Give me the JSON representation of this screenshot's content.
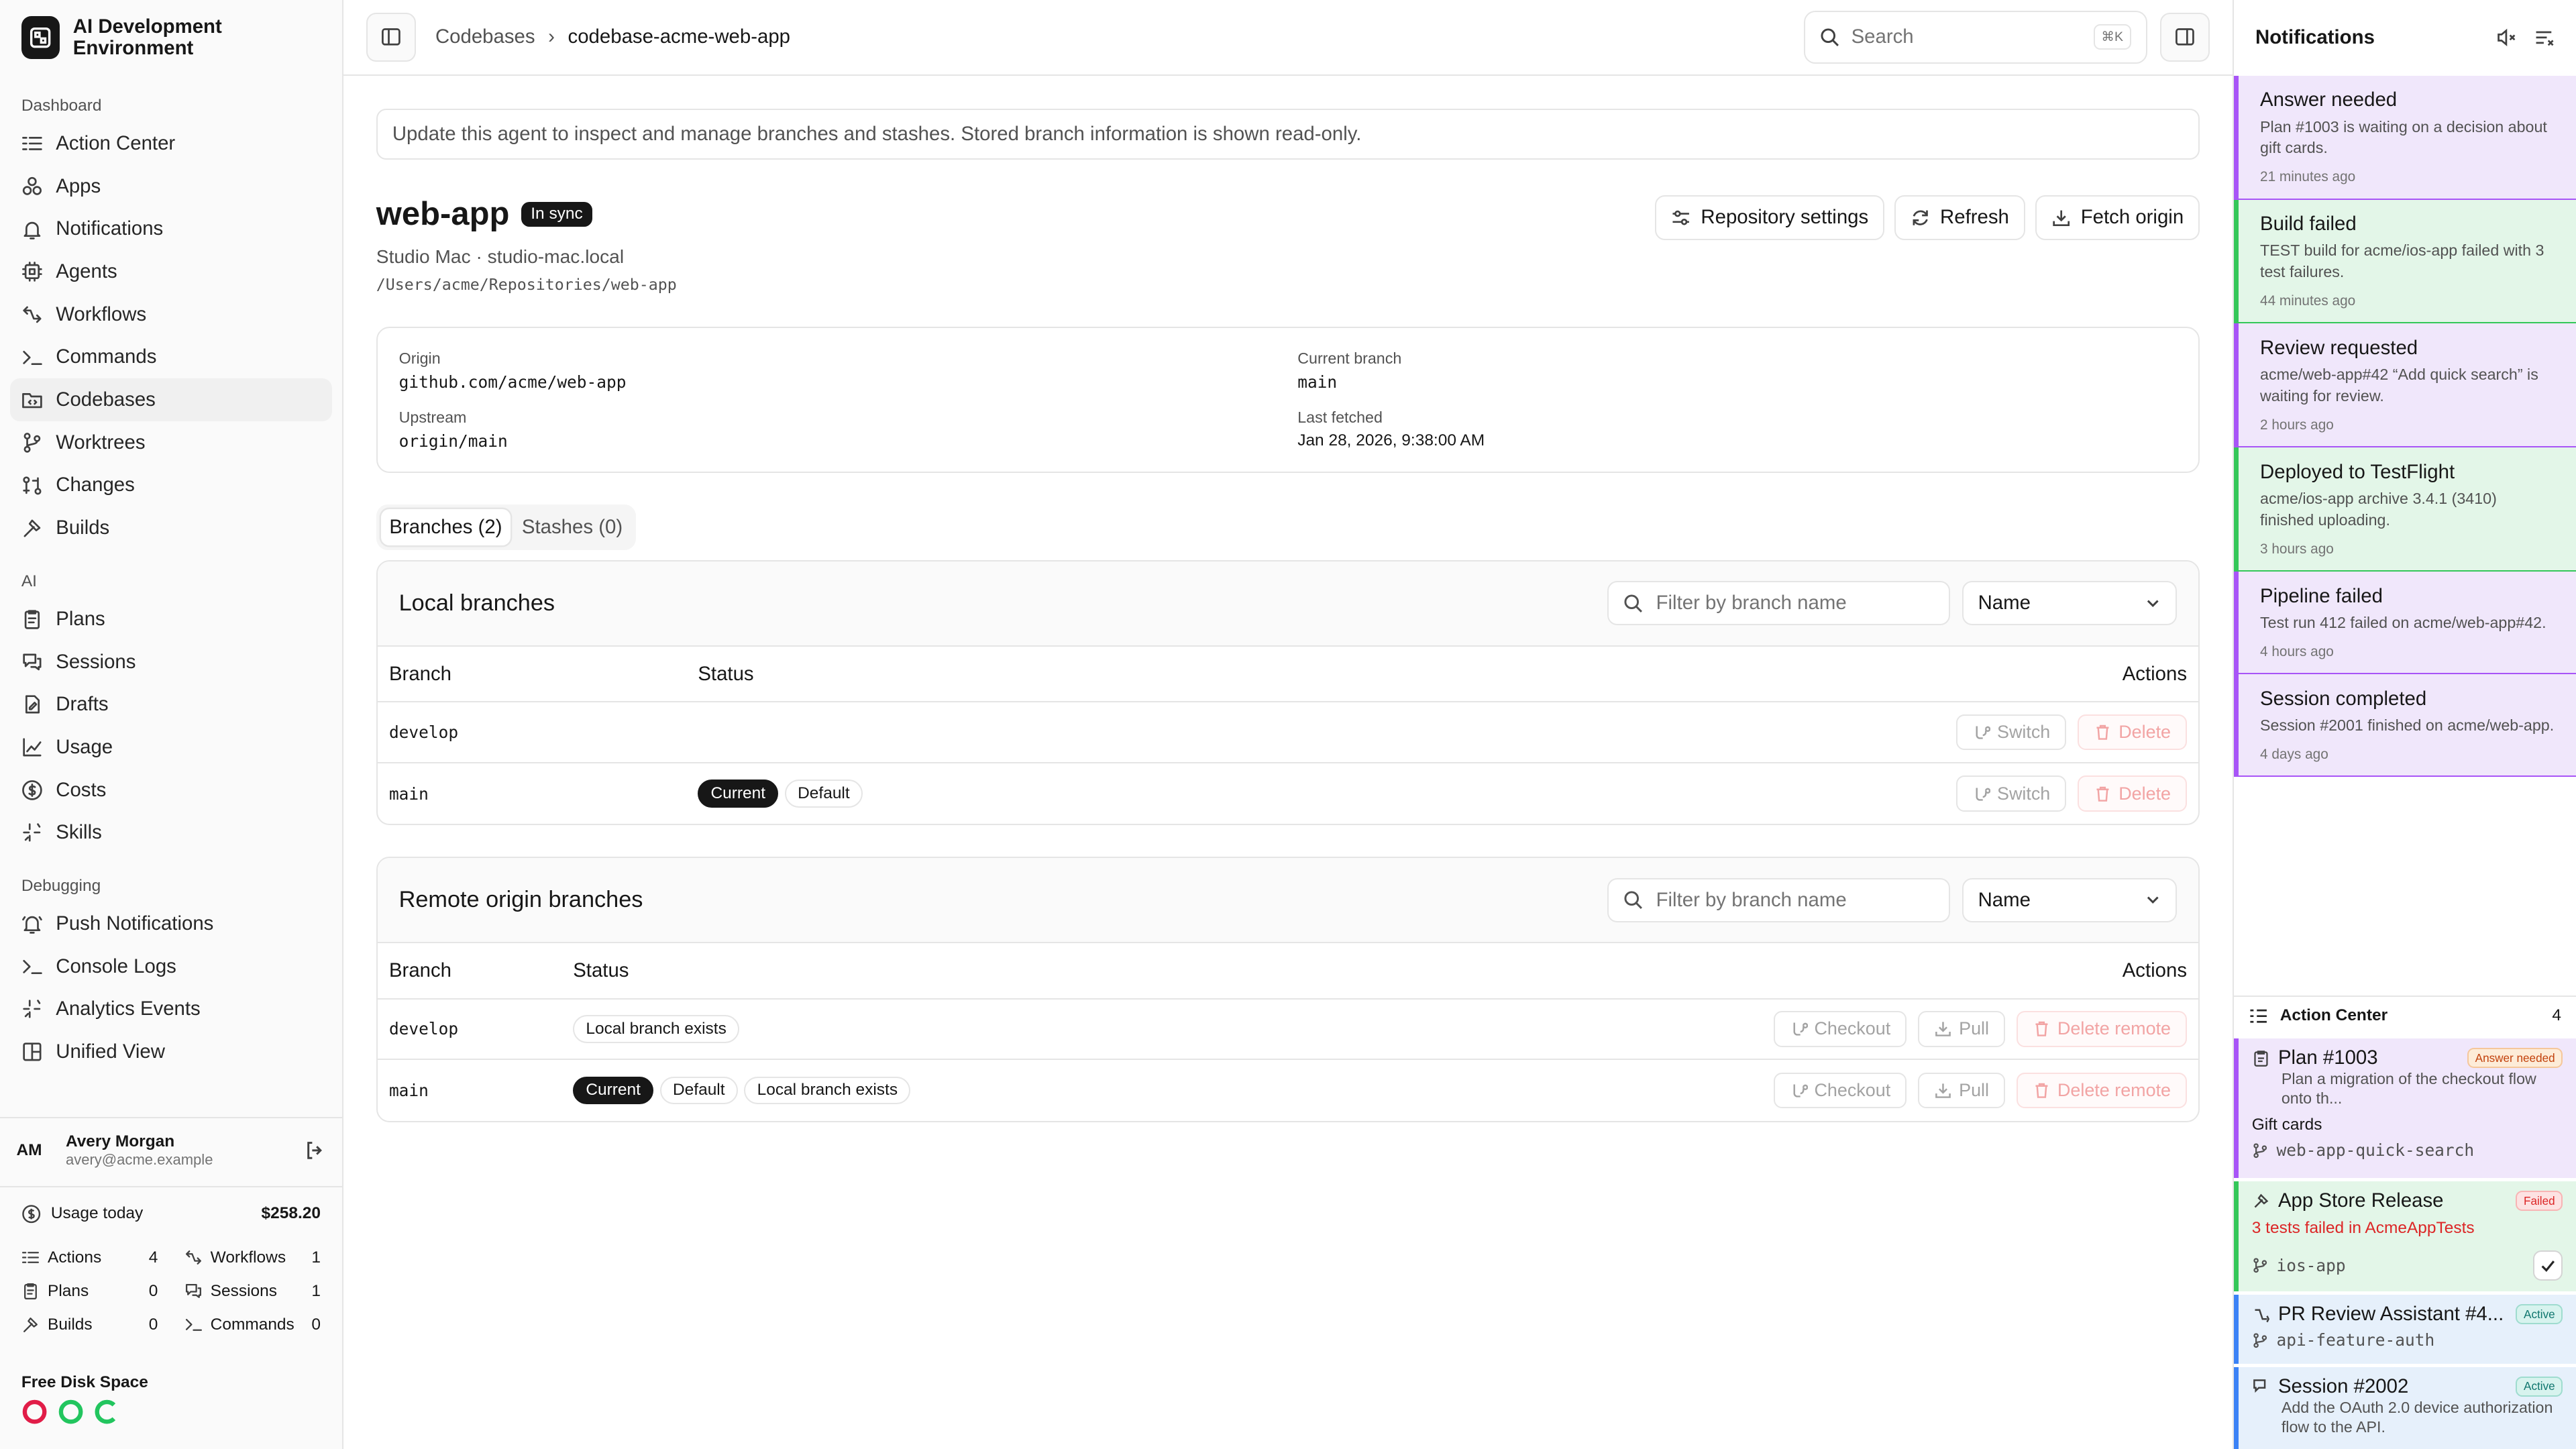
{
  "app": {
    "title": "AI Development Environment"
  },
  "sidebar": {
    "sections": [
      {
        "label": "Dashboard",
        "items": [
          {
            "label": "Action Center",
            "icon": "list-check-icon"
          },
          {
            "label": "Apps",
            "icon": "apps-icon"
          },
          {
            "label": "Notifications",
            "icon": "bell-icon"
          },
          {
            "label": "Agents",
            "icon": "cpu-icon"
          },
          {
            "label": "Workflows",
            "icon": "workflow-icon"
          },
          {
            "label": "Commands",
            "icon": "terminal-icon"
          },
          {
            "label": "Codebases",
            "icon": "folder-code-icon",
            "active": true
          },
          {
            "label": "Worktrees",
            "icon": "branch-icon"
          },
          {
            "label": "Changes",
            "icon": "diff-icon"
          },
          {
            "label": "Builds",
            "icon": "hammer-icon"
          }
        ]
      },
      {
        "label": "AI",
        "items": [
          {
            "label": "Plans",
            "icon": "clipboard-icon"
          },
          {
            "label": "Sessions",
            "icon": "chat-icon"
          },
          {
            "label": "Drafts",
            "icon": "file-edit-icon"
          },
          {
            "label": "Usage",
            "icon": "chart-icon"
          },
          {
            "label": "Costs",
            "icon": "dollar-icon"
          },
          {
            "label": "Skills",
            "icon": "sparkle-icon"
          }
        ]
      },
      {
        "label": "Debugging",
        "items": [
          {
            "label": "Push Notifications",
            "icon": "bell-ring-icon"
          },
          {
            "label": "Console Logs",
            "icon": "terminal-icon"
          },
          {
            "label": "Analytics Events",
            "icon": "sparkle-icon"
          },
          {
            "label": "Unified View",
            "icon": "layout-icon"
          }
        ]
      }
    ],
    "user": {
      "initials": "AM",
      "name": "Avery Morgan",
      "email": "avery@acme.example"
    },
    "usage": {
      "label": "Usage today",
      "amount": "$258.20"
    },
    "stats": [
      {
        "label": "Actions",
        "value": "4"
      },
      {
        "label": "Workflows",
        "value": "1"
      },
      {
        "label": "Plans",
        "value": "0"
      },
      {
        "label": "Sessions",
        "value": "1"
      },
      {
        "label": "Builds",
        "value": "0"
      },
      {
        "label": "Commands",
        "value": "0"
      }
    ],
    "disk": {
      "label": "Free Disk Space"
    }
  },
  "header": {
    "breadcrumb": [
      "Codebases",
      "codebase-acme-web-app"
    ],
    "search_placeholder": "Search",
    "search_kbd": "⌘K"
  },
  "main": {
    "notice": "Update this agent to inspect and manage branches and stashes. Stored branch information is shown read-only.",
    "repo": {
      "name": "web-app",
      "status": "In sync",
      "host": "Studio Mac · studio-mac.local",
      "path": "/Users/acme/Repositories/web-app"
    },
    "actions": [
      "Repository settings",
      "Refresh",
      "Fetch origin"
    ],
    "info": {
      "origin_label": "Origin",
      "origin": "github.com/acme/web-app",
      "branch_label": "Current branch",
      "branch": "main",
      "upstream_label": "Upstream",
      "upstream": "origin/main",
      "fetched_label": "Last fetched",
      "fetched": "Jan 28, 2026, 9:38:00 AM"
    },
    "tabs": [
      "Branches (2)",
      "Stashes (0)"
    ],
    "local": {
      "title": "Local branches",
      "filter_placeholder": "Filter by branch name",
      "sort": "Name",
      "columns": [
        "Branch",
        "Status",
        "Actions"
      ],
      "rows": [
        {
          "name": "develop",
          "badges": [],
          "actions": [
            "Switch",
            "Delete"
          ]
        },
        {
          "name": "main",
          "badges": [
            "Current",
            "Default"
          ],
          "actions": [
            "Switch",
            "Delete"
          ]
        }
      ]
    },
    "remote": {
      "title": "Remote origin branches",
      "filter_placeholder": "Filter by branch name",
      "sort": "Name",
      "columns": [
        "Branch",
        "Status",
        "Actions"
      ],
      "rows": [
        {
          "name": "develop",
          "badges": [
            "Local branch exists"
          ],
          "actions": [
            "Checkout",
            "Pull",
            "Delete remote"
          ]
        },
        {
          "name": "main",
          "badges": [
            "Current",
            "Default",
            "Local branch exists"
          ],
          "actions": [
            "Checkout",
            "Pull",
            "Delete remote"
          ]
        }
      ]
    }
  },
  "notifications": {
    "title": "Notifications",
    "items": [
      {
        "title": "Answer needed",
        "desc": "Plan #1003 is waiting on a decision about gift cards.",
        "age": "21 minutes ago",
        "color": "purple"
      },
      {
        "title": "Build failed",
        "desc": "TEST build for acme/ios-app failed with 3 test failures.",
        "age": "44 minutes ago",
        "color": "green"
      },
      {
        "title": "Review requested",
        "desc": "acme/web-app#42 “Add quick search” is waiting for review.",
        "age": "2 hours ago",
        "color": "purple"
      },
      {
        "title": "Deployed to TestFlight",
        "desc": "acme/ios-app archive 3.4.1 (3410) finished uploading.",
        "age": "3 hours ago",
        "color": "green"
      },
      {
        "title": "Pipeline failed",
        "desc": "Test run 412 failed on acme/web-app#42.",
        "age": "4 hours ago",
        "color": "purple"
      },
      {
        "title": "Session completed",
        "desc": "Session #2001 finished on acme/web-app.",
        "age": "4 days ago",
        "color": "purple"
      }
    ]
  },
  "action_center": {
    "title": "Action Center",
    "count": "4",
    "cards": [
      {
        "title": "Plan #1003",
        "tag": "Answer needed",
        "desc": "Plan a migration of the checkout flow onto th...",
        "extra": "Gift cards",
        "foot": "web-app-quick-search"
      },
      {
        "title": "App Store Release",
        "tag": "Failed",
        "desc": "3 tests failed in AcmeAppTests",
        "foot": "ios-app"
      },
      {
        "title": "PR Review Assistant #4...",
        "tag": "Active",
        "foot": "api-feature-auth"
      },
      {
        "title": "Session #2002",
        "tag": "Active",
        "desc": "Add the OAuth 2.0 device authorization flow to the API."
      }
    ]
  }
}
